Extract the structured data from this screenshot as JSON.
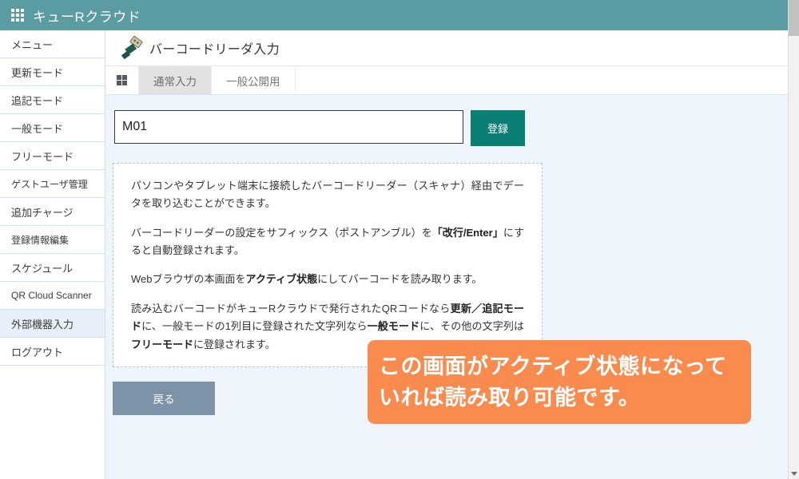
{
  "topbar": {
    "launcher_icon": "apps-grid-icon",
    "brand": "キューRクラウド",
    "bg_color": "#5a9ca1"
  },
  "sidebar": {
    "items": [
      {
        "label": "メニュー",
        "active": false
      },
      {
        "label": "更新モード",
        "active": false
      },
      {
        "label": "追記モード",
        "active": false
      },
      {
        "label": "一般モード",
        "active": false
      },
      {
        "label": "フリーモード",
        "active": false
      },
      {
        "label": "ゲストユーザ管理",
        "active": false
      },
      {
        "label": "追加チャージ",
        "active": false
      },
      {
        "label": "登録情報編集",
        "active": false
      },
      {
        "label": "スケジュール",
        "active": false
      },
      {
        "label": "QR Cloud Scanner",
        "active": false
      },
      {
        "label": "外部機器入力",
        "active": true
      },
      {
        "label": "ログアウト",
        "active": false
      }
    ],
    "active_bg": "#e7f0f8"
  },
  "page": {
    "icon": "usb-plug-icon",
    "title": "バーコードリーダ入力"
  },
  "tabs": {
    "grid_icon": "grid-view-icon",
    "items": [
      {
        "label": "通常入力",
        "active": true
      },
      {
        "label": "一般公開用",
        "active": false
      }
    ]
  },
  "form": {
    "input_value": "M01",
    "input_placeholder": "",
    "register_label": "登録",
    "register_color": "#0b7f74"
  },
  "info": {
    "paragraphs": [
      "パソコンやタブレット端末に接続したバーコードリーダー（スキャナ）経由でデータを取り込むことができます。",
      "バーコードリーダーの設定をサフィックス（ポストアンブル）を「改行/Enter」にすると自動登録されます。",
      "Webブラウザの本画面をアクティブ状態にしてバーコードを読み取ります。",
      "読み込むバーコードがキューRクラウドで発行されたQRコードなら更新／追記モードに、一般モードの1列目に登録された文字列なら一般モードに、その他の文字列はフリーモードに登録されます。"
    ],
    "bold_segments": [
      "「改行/Enter」",
      "アクティブ状態",
      "更新／追記モード",
      "一般モード",
      "フリーモード"
    ]
  },
  "back_button": {
    "label": "戻る",
    "color": "#7f93a8"
  },
  "callout": {
    "text": "この画面がアクティブ状態になっていれば読み取り可能です。",
    "bg_color": "#f98b4e",
    "text_color": "#ffffff"
  },
  "scrollbar": {
    "thumb_label": "vertical-scroll-thumb",
    "arrow_label": "scroll-down-arrow"
  }
}
